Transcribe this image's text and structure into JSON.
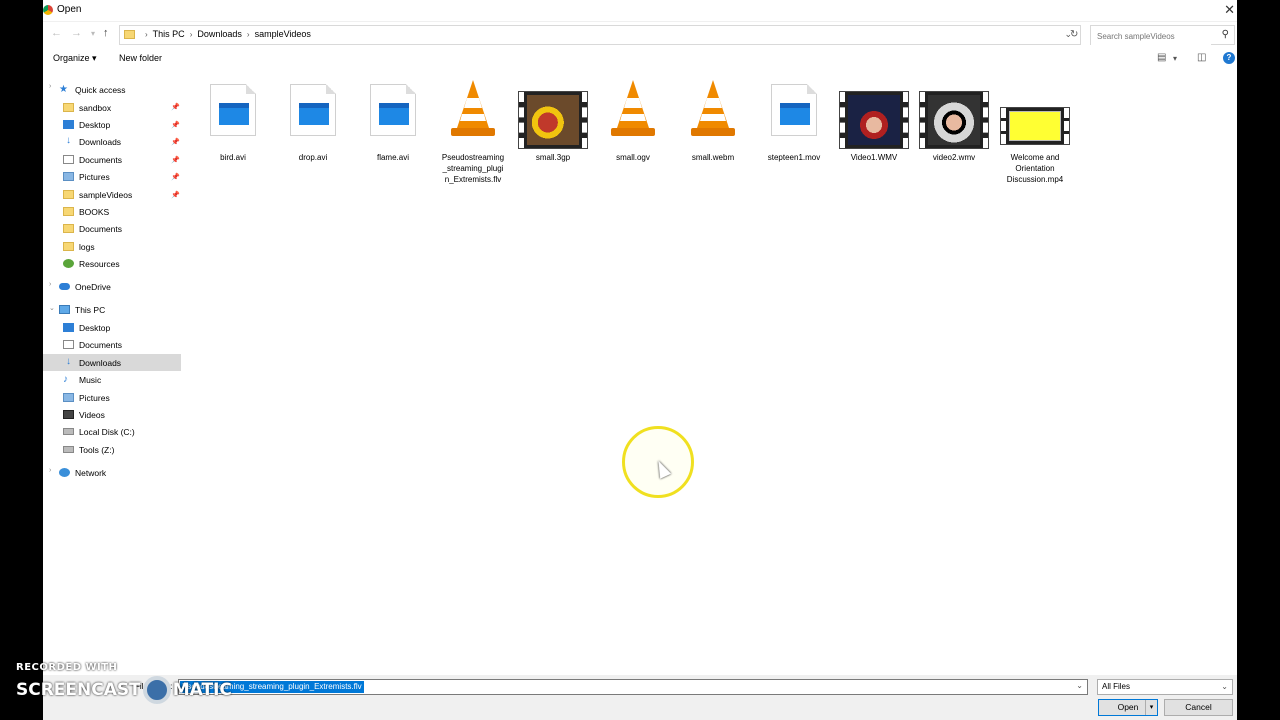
{
  "window": {
    "title": "Open"
  },
  "address": {
    "crumbs": [
      "This PC",
      "Downloads",
      "sampleVideos"
    ],
    "search_placeholder": "Search sampleVideos"
  },
  "toolbar": {
    "organize_label": "Organize",
    "new_folder_label": "New folder"
  },
  "nav": {
    "quick_access": "Quick access",
    "quick_items": [
      "sandbox",
      "Desktop",
      "Downloads",
      "Documents",
      "Pictures",
      "sampleVideos",
      "BOOKS",
      "Documents",
      "logs",
      "Resources"
    ],
    "onedrive": "OneDrive",
    "this_pc": "This PC",
    "pc_items": [
      "Desktop",
      "Documents",
      "Downloads",
      "Music",
      "Pictures",
      "Videos",
      "Local Disk (C:)",
      "Tools (Z:)"
    ],
    "network": "Network",
    "selected": "Downloads"
  },
  "files": [
    {
      "name": "bird.avi",
      "icon": "video-doc-icon"
    },
    {
      "name": "drop.avi",
      "icon": "video-doc-icon"
    },
    {
      "name": "flame.avi",
      "icon": "video-doc-icon"
    },
    {
      "name": "Pseudostreaming_streaming_plugin_Extremists.flv",
      "display": "Pseudostreaming\n_streaming_plugi\nn_Extremists.flv",
      "icon": "vlc-cone-icon"
    },
    {
      "name": "small.3gp",
      "icon": "film-thumbnail"
    },
    {
      "name": "small.ogv",
      "icon": "vlc-cone-icon"
    },
    {
      "name": "small.webm",
      "icon": "vlc-cone-icon"
    },
    {
      "name": "stepteen1.mov",
      "icon": "video-doc-icon"
    },
    {
      "name": "Video1.WMV",
      "icon": "film-thumbnail"
    },
    {
      "name": "video2.wmv",
      "icon": "film-thumbnail"
    },
    {
      "name": "Welcome and Orientation Discussion.mp4",
      "display": "Welcome and\nOrientation\nDiscussion.mp4",
      "icon": "film-thumbnail"
    }
  ],
  "bottom": {
    "file_name_label": "File name:",
    "file_name_value": "Pseudostreaming_streaming_plugin_Extremists.flv",
    "filter_value": "All Files",
    "open_label": "Open",
    "cancel_label": "Cancel"
  },
  "watermark": {
    "line1": "RECORDED WITH",
    "line2a": "SCREENCAST",
    "line2b": "MATIC"
  },
  "colors": {
    "selection": "#0078d7",
    "cursor_highlight": "#f0e020"
  }
}
